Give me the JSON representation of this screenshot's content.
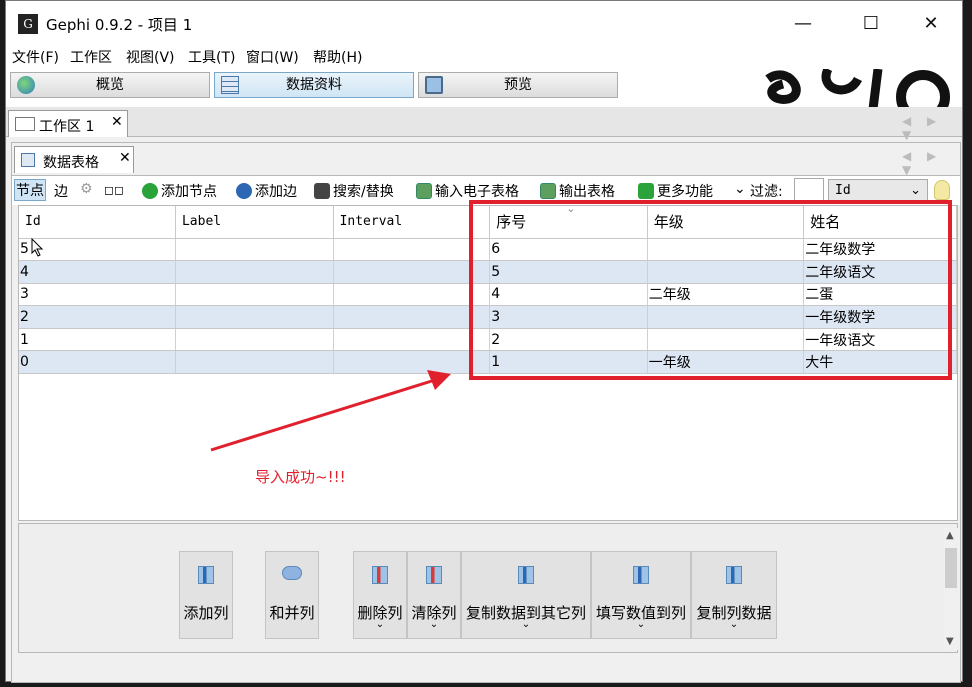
{
  "window": {
    "title": "Gephi 0.9.2 - 项目 1",
    "app_icon_label": "G",
    "minimize_glyph": "—",
    "maximize_glyph": "☐",
    "close_glyph": "✕"
  },
  "menubar": [
    "文件(F)",
    "工作区",
    "视图(V)",
    "工具(T)",
    "窗口(W)",
    "帮助(H)"
  ],
  "viewtabs": [
    {
      "label": "概览",
      "icon": "globe-icon"
    },
    {
      "label": "数据资料",
      "icon": "table-icon",
      "active": true
    },
    {
      "label": "预览",
      "icon": "monitor-icon"
    }
  ],
  "workspace_tab": {
    "label": "工作区 1",
    "close": "✕"
  },
  "datatable_tab": {
    "label": "数据表格",
    "close": "✕"
  },
  "nav_arrows": "◀ ▶ ▼",
  "toolbar": {
    "nodes": "节点",
    "edges": "边",
    "config_glyph": "◻◻",
    "add_node": "添加节点",
    "add_edge": "添加边",
    "search_replace": "搜索/替换",
    "import_spreadsheet": "输入电子表格",
    "export_table": "输出表格",
    "more_actions": "更多功能",
    "filter_chevron": "⌄",
    "filter_label": "过滤:",
    "filter_input_value": "",
    "filter_column": "Id",
    "dropdown_glyph": "⌄"
  },
  "table": {
    "columns": [
      "Id",
      "Label",
      "Interval",
      "序号",
      "年级",
      "姓名"
    ],
    "sort_indicator": "⌄",
    "rows": [
      [
        "5",
        "",
        "",
        "6",
        "",
        "二年级数学"
      ],
      [
        "4",
        "",
        "",
        "5",
        "",
        "二年级语文"
      ],
      [
        "3",
        "",
        "",
        "4",
        "二年级",
        "二蛋"
      ],
      [
        "2",
        "",
        "",
        "3",
        "",
        "一年级数学"
      ],
      [
        "1",
        "",
        "",
        "2",
        "",
        "一年级语文"
      ],
      [
        "0",
        "",
        "",
        "1",
        "一年级",
        "大牛"
      ]
    ]
  },
  "annotation": {
    "text": "导入成功~!!!",
    "color": "#e0212d"
  },
  "column_actions": [
    {
      "label": "添加列",
      "icon": "column-icon"
    },
    {
      "label": "和并列",
      "icon": "merge-icon"
    },
    {
      "label": "删除列",
      "icon": "column-icon",
      "dropdown": true
    },
    {
      "label": "清除列",
      "icon": "column-icon",
      "dropdown": true
    },
    {
      "label": "复制数据到其它列",
      "icon": "column-icon",
      "dropdown": true
    },
    {
      "label": "填写数值到列",
      "icon": "column-icon",
      "dropdown": true
    },
    {
      "label": "复制列数据",
      "icon": "column-icon",
      "dropdown": true
    }
  ],
  "dropdown_mark": "⌄",
  "scroll_arrows": {
    "up": "▲",
    "down": "▼"
  }
}
